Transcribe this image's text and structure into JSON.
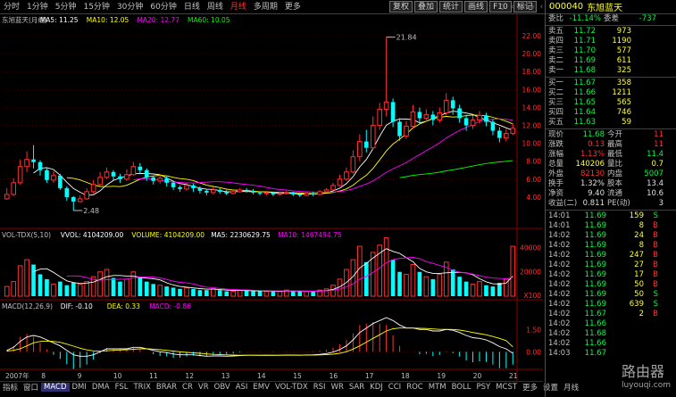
{
  "periods": [
    "分时",
    "1分钟",
    "5分钟",
    "15分钟",
    "30分钟",
    "60分钟",
    "日线",
    "周线",
    "月线",
    "多周期",
    "更多"
  ],
  "active_period": 8,
  "toolbar": [
    "复权",
    "叠加",
    "统计",
    "画线",
    "F10",
    "标记"
  ],
  "top_icons": [
    "◇",
    "‹",
    "«",
    "»",
    "‹",
    "›"
  ],
  "colors": {
    "up": "#ff3030",
    "down": "#00ffff",
    "ma5": "#ffffff",
    "ma10": "#ffff00",
    "ma20": "#ff00ff",
    "ma60": "#00ff00"
  },
  "kline": {
    "legend": [
      {
        "text": "东旭蓝天(月线)",
        "color": "#c0c0c0"
      },
      {
        "text": "MA5: 11.25",
        "color": "#ffffff"
      },
      {
        "text": "MA10: 12.05",
        "color": "#ffff00"
      },
      {
        "text": "MA20: 12.77",
        "color": "#ff00ff"
      },
      {
        "text": "MA60: 10.05",
        "color": "#00ff00"
      }
    ],
    "high_label": "21.84",
    "low_label": "2.48",
    "axis": [
      "22.00",
      "20.00",
      "18.00",
      "16.00",
      "14.00",
      "12.00",
      "10.00",
      "8.00",
      "6.00",
      "4.00"
    ]
  },
  "volume": {
    "legend": [
      {
        "text": "VOL-TDX(5,10)",
        "color": "#c0c0c0"
      },
      {
        "text": "VVOL: 4104209.00",
        "color": "#ffffff"
      },
      {
        "text": "VOLUME: 4104209.00",
        "color": "#ffff00"
      },
      {
        "text": "MA5: 2230629.75",
        "color": "#ffffff"
      },
      {
        "text": "MA10: 1467494.75",
        "color": "#ff00ff"
      }
    ],
    "axis": [
      "40000",
      "20000"
    ],
    "unit": "X100"
  },
  "macd": {
    "legend": [
      {
        "text": "MACD(12,26,9)",
        "color": "#c0c0c0"
      },
      {
        "text": "DIF: -0.10",
        "color": "#ffffff"
      },
      {
        "text": "DEA: 0.33",
        "color": "#ffff00"
      },
      {
        "text": "MACD: -0.86",
        "color": "#ff00ff"
      }
    ],
    "axis": [
      "1.50",
      "0.00"
    ]
  },
  "date_labels": [
    "2007年",
    "8",
    "9",
    "10",
    "11",
    "12",
    "13",
    "14",
    "15",
    "16",
    "17",
    "18",
    "19",
    "20",
    "21"
  ],
  "bottom_tabs": [
    "指标",
    "窗口",
    "MACD",
    "DMI",
    "DMA",
    "FSL",
    "TRIX",
    "BRAR",
    "CR",
    "VR",
    "OBV",
    "ASI",
    "EMV",
    "VOL-TDX",
    "RSI",
    "WR",
    "SAR",
    "KDJ",
    "CCI",
    "ROC",
    "MTM",
    "BOLL",
    "PSY",
    "MCST",
    "更多",
    "设置"
  ],
  "bottom_right": "月线",
  "quote": {
    "code": "000040",
    "name": "东旭蓝天",
    "weibi_label": "委比",
    "weibi": "-11.14%",
    "weicha_label": "委差",
    "weicha": "-737",
    "sells": [
      {
        "label": "卖五",
        "price": "11.72",
        "vol": "973"
      },
      {
        "label": "卖四",
        "price": "11.71",
        "vol": "1190"
      },
      {
        "label": "卖三",
        "price": "11.70",
        "vol": "577"
      },
      {
        "label": "卖二",
        "price": "11.69",
        "vol": "611"
      },
      {
        "label": "卖一",
        "price": "11.68",
        "vol": "325"
      }
    ],
    "buys": [
      {
        "label": "买一",
        "price": "11.67",
        "vol": "358"
      },
      {
        "label": "买二",
        "price": "11.66",
        "vol": "1211"
      },
      {
        "label": "买三",
        "price": "11.65",
        "vol": "565"
      },
      {
        "label": "买四",
        "price": "11.64",
        "vol": "746"
      },
      {
        "label": "买五",
        "price": "11.63",
        "vol": "59"
      }
    ],
    "stats": [
      {
        "l1": "现价",
        "v1": "11.68",
        "c1": "g",
        "l2": "今开",
        "v2": "11",
        "c2": "r"
      },
      {
        "l1": "涨跌",
        "v1": "0.13",
        "c1": "r",
        "l2": "最高",
        "v2": "11",
        "c2": "r"
      },
      {
        "l1": "涨幅",
        "v1": "1.13%",
        "c1": "r",
        "l2": "最低",
        "v2": "11.4",
        "c2": "g"
      },
      {
        "l1": "总量",
        "v1": "140206",
        "c1": "y",
        "l2": "量比",
        "v2": "0.7",
        "c2": "y"
      },
      {
        "l1": "外盘",
        "v1": "82130",
        "c1": "r",
        "l2": "内盘",
        "v2": "5007",
        "c2": "g"
      },
      {
        "l1": "换手",
        "v1": "1.32%",
        "c1": "w",
        "l2": "股本",
        "v2": "13.4",
        "c2": "w"
      },
      {
        "l1": "净资",
        "v1": "9.40",
        "c1": "w",
        "l2": "流通",
        "v2": "10.6",
        "c2": "w"
      },
      {
        "l1": "收益(二)",
        "v1": "0.811",
        "c1": "w",
        "l2": "PE(动)",
        "v2": "3",
        "c2": "w"
      }
    ],
    "ticks": [
      {
        "t": "14:01",
        "p": "11.69",
        "v": "159",
        "s": "S"
      },
      {
        "t": "14:01",
        "p": "11.69",
        "v": "8",
        "s": "B"
      },
      {
        "t": "14:02",
        "p": "11.69",
        "v": "24",
        "s": "B"
      },
      {
        "t": "14:02",
        "p": "11.69",
        "v": "8",
        "s": "B"
      },
      {
        "t": "14:02",
        "p": "11.69",
        "v": "247",
        "s": "B"
      },
      {
        "t": "14:02",
        "p": "11.69",
        "v": "27",
        "s": "B"
      },
      {
        "t": "14:02",
        "p": "11.69",
        "v": "17",
        "s": "B"
      },
      {
        "t": "14:02",
        "p": "11.69",
        "v": "50",
        "s": "B"
      },
      {
        "t": "14:02",
        "p": "11.69",
        "v": "50",
        "s": "S"
      },
      {
        "t": "14:02",
        "p": "11.69",
        "v": "639",
        "s": "S"
      },
      {
        "t": "14:02",
        "p": "11.67",
        "v": "2",
        "s": "B"
      },
      {
        "t": "14:02",
        "p": "11.66",
        "v": "",
        "s": ""
      },
      {
        "t": "14:02",
        "p": "11.68",
        "v": "",
        "s": ""
      },
      {
        "t": "14:02",
        "p": "11.66",
        "v": "",
        "s": ""
      },
      {
        "t": "14:03",
        "p": "11.67",
        "v": "",
        "s": ""
      }
    ]
  },
  "watermark": {
    "title": "路由器",
    "sub": "luyouqi.com"
  },
  "chart_data": {
    "type": "candlestick",
    "title": "东旭蓝天(月线)",
    "ylim": [
      2,
      23
    ],
    "candles": [
      [
        3.8,
        4.3,
        5.0,
        3.7
      ],
      [
        4.3,
        5.6,
        6.1,
        4.1
      ],
      [
        5.6,
        7.4,
        8.2,
        5.4
      ],
      [
        7.4,
        8.2,
        9.1,
        6.8
      ],
      [
        8.2,
        7.9,
        9.8,
        7.2
      ],
      [
        7.9,
        7.0,
        8.1,
        6.4
      ],
      [
        7.0,
        5.9,
        7.2,
        5.6
      ],
      [
        5.9,
        6.4,
        6.9,
        5.6
      ],
      [
        6.4,
        5.0,
        6.6,
        4.8
      ],
      [
        5.0,
        4.0,
        5.2,
        3.6
      ],
      [
        4.0,
        3.5,
        4.1,
        2.5
      ],
      [
        3.5,
        3.8,
        4.2,
        3.4
      ],
      [
        3.8,
        4.6,
        5.0,
        3.7
      ],
      [
        4.6,
        5.4,
        5.9,
        4.4
      ],
      [
        5.4,
        6.2,
        6.8,
        5.3
      ],
      [
        6.2,
        6.8,
        7.3,
        6.0
      ],
      [
        6.8,
        6.3,
        7.0,
        5.9
      ],
      [
        6.3,
        6.0,
        6.6,
        5.6
      ],
      [
        6.0,
        6.5,
        7.1,
        5.8
      ],
      [
        6.5,
        7.4,
        7.9,
        6.4
      ],
      [
        7.4,
        7.0,
        7.8,
        6.6
      ],
      [
        7.0,
        6.2,
        7.2,
        5.8
      ],
      [
        6.2,
        5.8,
        6.4,
        5.4
      ],
      [
        5.8,
        6.1,
        6.6,
        5.5
      ],
      [
        6.1,
        5.6,
        6.3,
        5.2
      ],
      [
        5.6,
        5.1,
        5.8,
        4.8
      ],
      [
        5.1,
        4.9,
        5.3,
        4.6
      ],
      [
        4.9,
        5.3,
        5.6,
        4.7
      ],
      [
        5.3,
        5.0,
        5.5,
        4.6
      ],
      [
        5.0,
        4.7,
        5.2,
        4.4
      ],
      [
        4.7,
        4.5,
        4.9,
        4.2
      ],
      [
        4.5,
        4.8,
        5.1,
        4.3
      ],
      [
        4.8,
        4.6,
        5.0,
        4.4
      ],
      [
        4.6,
        4.4,
        4.8,
        4.2
      ],
      [
        4.4,
        4.6,
        4.8,
        4.3
      ],
      [
        4.6,
        4.8,
        5.0,
        4.5
      ],
      [
        4.8,
        4.7,
        5.0,
        4.5
      ],
      [
        4.7,
        4.5,
        4.9,
        4.3
      ],
      [
        4.5,
        4.4,
        4.6,
        4.2
      ],
      [
        4.4,
        4.5,
        4.7,
        4.2
      ],
      [
        4.5,
        4.3,
        4.6,
        4.1
      ],
      [
        4.3,
        4.4,
        4.6,
        4.2
      ],
      [
        4.4,
        4.5,
        4.7,
        4.3
      ],
      [
        4.5,
        4.3,
        4.6,
        4.1
      ],
      [
        4.3,
        4.2,
        4.5,
        4.0
      ],
      [
        4.2,
        4.4,
        4.6,
        4.1
      ],
      [
        4.4,
        4.3,
        4.6,
        4.1
      ],
      [
        4.3,
        4.6,
        4.8,
        4.2
      ],
      [
        4.6,
        4.8,
        5.0,
        4.5
      ],
      [
        4.8,
        5.3,
        5.6,
        4.7
      ],
      [
        5.3,
        6.0,
        6.5,
        5.2
      ],
      [
        6.0,
        6.8,
        7.3,
        5.8
      ],
      [
        6.8,
        8.5,
        9.2,
        6.6
      ],
      [
        8.5,
        10.2,
        11.0,
        8.0
      ],
      [
        10.2,
        9.5,
        11.5,
        9.0
      ],
      [
        9.5,
        12.0,
        13.0,
        9.3
      ],
      [
        12.0,
        13.8,
        14.5,
        11.5
      ],
      [
        13.8,
        14.6,
        21.84,
        13.0
      ],
      [
        14.6,
        12.4,
        15.0,
        11.8
      ],
      [
        12.4,
        10.8,
        12.8,
        10.3
      ],
      [
        10.8,
        11.9,
        12.5,
        10.5
      ],
      [
        11.9,
        13.5,
        14.3,
        11.6
      ],
      [
        13.5,
        12.8,
        14.0,
        12.2
      ],
      [
        12.8,
        13.2,
        13.8,
        12.4
      ],
      [
        13.2,
        12.6,
        13.6,
        12.0
      ],
      [
        12.6,
        13.4,
        14.0,
        12.3
      ],
      [
        13.4,
        14.8,
        15.6,
        13.1
      ],
      [
        14.8,
        13.9,
        15.2,
        13.2
      ],
      [
        13.9,
        12.8,
        14.3,
        12.3
      ],
      [
        12.8,
        12.0,
        13.2,
        11.4
      ],
      [
        12.0,
        12.6,
        13.1,
        11.6
      ],
      [
        12.6,
        13.1,
        13.6,
        12.2
      ],
      [
        13.1,
        12.4,
        13.4,
        11.9
      ],
      [
        12.4,
        11.4,
        12.7,
        10.9
      ],
      [
        11.4,
        10.6,
        11.8,
        10.1
      ],
      [
        10.6,
        11.1,
        11.6,
        10.2
      ],
      [
        11.1,
        11.68,
        12.2,
        10.9
      ]
    ],
    "volume": [
      8,
      12,
      25,
      30,
      26,
      18,
      14,
      10,
      12,
      9,
      11,
      10,
      12,
      16,
      20,
      22,
      15,
      12,
      14,
      20,
      16,
      12,
      10,
      9,
      8,
      7,
      6,
      7,
      6,
      5,
      5,
      6,
      5,
      4,
      4,
      5,
      5,
      4,
      4,
      4,
      4,
      4,
      5,
      4,
      4,
      4,
      4,
      5,
      6,
      9,
      14,
      22,
      30,
      41,
      28,
      36,
      42,
      48,
      30,
      20,
      18,
      26,
      20,
      16,
      14,
      18,
      28,
      22,
      16,
      12,
      10,
      12,
      9,
      8,
      11,
      14,
      41
    ],
    "macd": {
      "dif": [
        0.1,
        0.3,
        0.7,
        1.0,
        1.1,
        1.0,
        0.8,
        0.6,
        0.4,
        0.1,
        -0.2,
        -0.3,
        -0.3,
        -0.2,
        0.0,
        0.2,
        0.2,
        0.2,
        0.2,
        0.3,
        0.3,
        0.2,
        0.1,
        0.0,
        -0.05,
        -0.15,
        -0.2,
        -0.2,
        -0.2,
        -0.25,
        -0.3,
        -0.28,
        -0.28,
        -0.3,
        -0.28,
        -0.25,
        -0.23,
        -0.23,
        -0.24,
        -0.23,
        -0.24,
        -0.23,
        -0.22,
        -0.22,
        -0.23,
        -0.21,
        -0.2,
        -0.17,
        -0.12,
        -0.02,
        0.15,
        0.4,
        0.8,
        1.3,
        1.6,
        1.9,
        2.1,
        2.3,
        2.1,
        1.8,
        1.6,
        1.6,
        1.5,
        1.5,
        1.4,
        1.4,
        1.5,
        1.45,
        1.3,
        1.1,
        0.95,
        0.9,
        0.8,
        0.6,
        0.35,
        0.2,
        -0.1
      ],
      "dea": [
        0.05,
        0.1,
        0.2,
        0.4,
        0.6,
        0.7,
        0.72,
        0.7,
        0.64,
        0.52,
        0.38,
        0.24,
        0.13,
        0.06,
        0.04,
        0.07,
        0.1,
        0.12,
        0.14,
        0.17,
        0.2,
        0.2,
        0.18,
        0.14,
        0.1,
        0.05,
        0.0,
        -0.04,
        -0.07,
        -0.1,
        -0.14,
        -0.17,
        -0.19,
        -0.21,
        -0.22,
        -0.23,
        -0.23,
        -0.23,
        -0.23,
        -0.23,
        -0.23,
        -0.23,
        -0.23,
        -0.23,
        -0.23,
        -0.22,
        -0.22,
        -0.21,
        -0.19,
        -0.16,
        -0.1,
        0.0,
        0.18,
        0.4,
        0.65,
        0.9,
        1.15,
        1.4,
        1.55,
        1.6,
        1.6,
        1.6,
        1.58,
        1.57,
        1.54,
        1.51,
        1.51,
        1.5,
        1.46,
        1.39,
        1.3,
        1.22,
        1.14,
        1.03,
        0.9,
        0.75,
        0.33
      ]
    }
  }
}
